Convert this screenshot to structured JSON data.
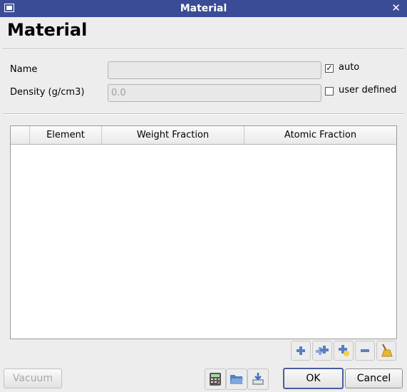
{
  "window": {
    "title": "Material"
  },
  "heading": "Material",
  "form": {
    "name_label": "Name",
    "name_value": "",
    "density_label": "Density (g/cm3)",
    "density_value": "0.0",
    "auto_label": "auto",
    "auto_checked": true,
    "user_defined_label": "user defined",
    "user_defined_checked": false
  },
  "table": {
    "columns": [
      "",
      "Element",
      "Weight Fraction",
      "Atomic Fraction"
    ],
    "rows": []
  },
  "table_tools": [
    "add-icon",
    "add-multiple-icon",
    "add-special-icon",
    "remove-icon",
    "clear-broom-icon"
  ],
  "bottom": {
    "vacuum_label": "Vacuum",
    "ok_label": "OK",
    "cancel_label": "Cancel",
    "tools": [
      "calculator-icon",
      "open-folder-icon",
      "save-icon"
    ]
  },
  "colors": {
    "titlebar": "#3a4c96",
    "accent": "#4a5d9c"
  }
}
